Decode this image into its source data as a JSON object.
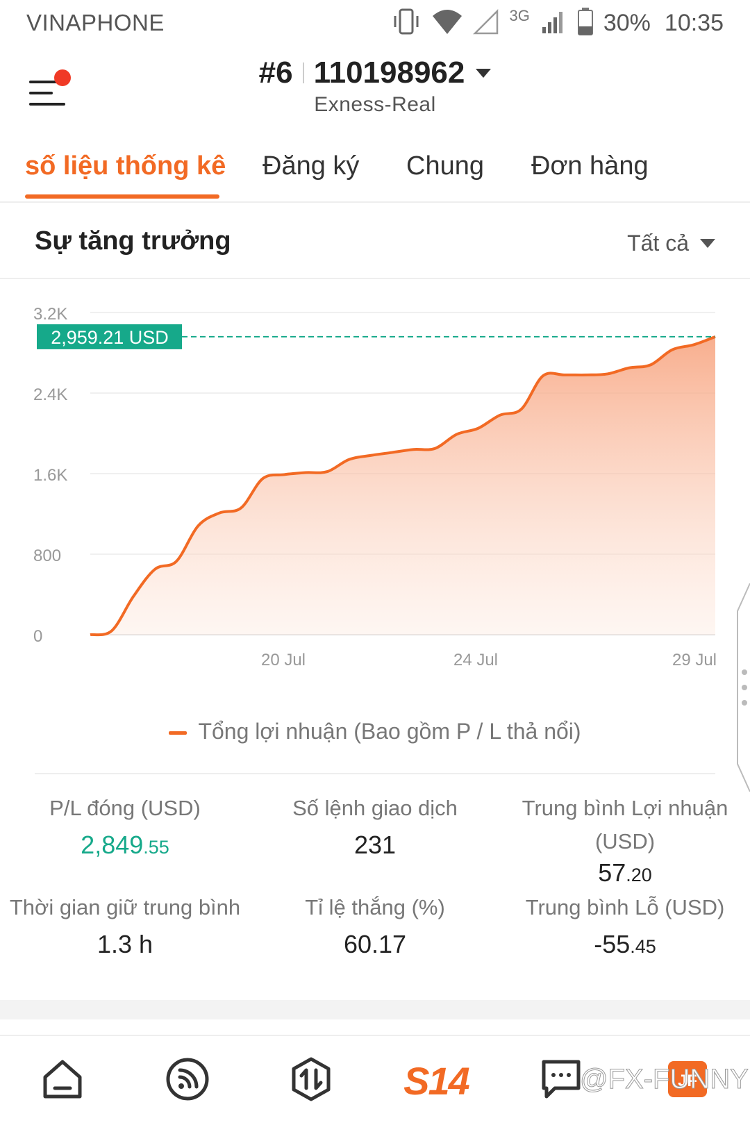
{
  "status_bar": {
    "carrier": "VINAPHONE",
    "network": "3G",
    "battery": "30%",
    "time": "10:35"
  },
  "header": {
    "account_rank": "#6",
    "account_number": "110198962",
    "server": "Exness-Real"
  },
  "tabs": [
    {
      "label": "số liệu thống kê",
      "active": true
    },
    {
      "label": "Đăng ký",
      "active": false
    },
    {
      "label": "Chung",
      "active": false
    },
    {
      "label": "Đơn hàng",
      "active": false
    }
  ],
  "section": {
    "title": "Sự tăng trưởng",
    "filter_label": "Tất cả"
  },
  "chart_data": {
    "type": "area",
    "y_ticks": [
      "0",
      "800",
      "1.6K",
      "2.4K",
      "3.2K"
    ],
    "ylim": [
      0,
      3200
    ],
    "x_tick_labels": [
      "20 Jul",
      "24 Jul",
      "29 Jul"
    ],
    "current_value_label": "2,959.21 USD",
    "current_value": 2959.21,
    "legend": "Tổng lợi nhuận (Bao gồm P / L thả nổi)",
    "series": [
      {
        "name": "Tổng lợi nhuận (Bao gồm P / L thả nổi)",
        "color": "#f26a24",
        "values": [
          0,
          40,
          380,
          650,
          730,
          1080,
          1210,
          1260,
          1550,
          1590,
          1610,
          1620,
          1740,
          1780,
          1810,
          1840,
          1850,
          1990,
          2050,
          2180,
          2240,
          2570,
          2580,
          2580,
          2590,
          2650,
          2680,
          2830,
          2880,
          2959.21
        ]
      }
    ]
  },
  "stats": {
    "closed_pl": {
      "label": "P/L đóng (USD)",
      "int": "2,849",
      "dec": ".55"
    },
    "trade_count": {
      "label": "Số lệnh giao dịch",
      "value": "231"
    },
    "avg_profit": {
      "label": "Trung bình Lợi nhuận (USD)",
      "int": "57",
      "dec": ".20"
    },
    "avg_hold": {
      "label": "Thời gian giữ trung bình",
      "value": "1.3 h"
    },
    "win_rate": {
      "label": "Tỉ lệ thắng (%)",
      "value": "60.17"
    },
    "avg_loss": {
      "label": "Trung bình Lỗ (USD)",
      "int": "-55",
      "dec": ".45"
    }
  },
  "bottom_nav": {
    "s14_label": "S14",
    "watermark": "@FX-FUNNY"
  },
  "colors": {
    "accent": "#f26a24",
    "green": "#16a98a",
    "alert_dot": "#f03a26"
  }
}
